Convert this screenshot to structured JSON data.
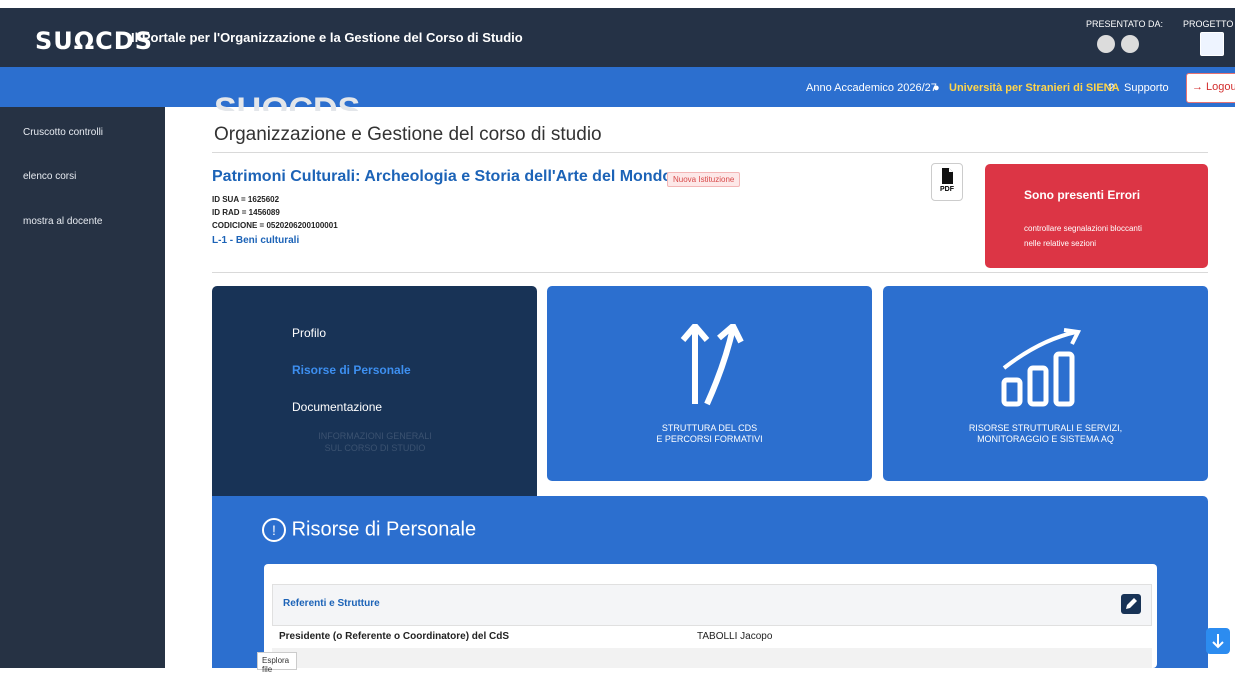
{
  "header": {
    "logo": "SUΩCDS",
    "title": "Il Portale per l'Organizzazione e la Gestione del Corso di Studio",
    "presented_by": "PRESENTATO DA:",
    "project_by": "PROGETTO DI"
  },
  "nav": {
    "academic_year": "Anno Accademico 2026/27",
    "university": "Università per Stranieri di SIENA",
    "support": "Supporto",
    "logout": "Logout"
  },
  "sidebar": {
    "items": [
      {
        "label": "Cruscotto controlli"
      },
      {
        "label": "elenco corsi"
      },
      {
        "label": "mostra al docente"
      }
    ]
  },
  "page": {
    "title": "Organizzazione e Gestione del corso di studio"
  },
  "course": {
    "title": "Patrimoni Culturali: Archeologia e Storia dell'Arte del Mondo",
    "tag": "Nuova Istituzione",
    "id_sua": "ID SUA = 1625602",
    "id_rad": "ID RAD = 1456089",
    "codicione": "CODICIONE = 0520206200100001",
    "classe": "L-1 - Beni culturali",
    "pdf_label": "PDF"
  },
  "errors": {
    "title": "Sono presenti Errori",
    "line1": "controllare segnalazioni bloccanti",
    "line2": "nelle relative sezioni"
  },
  "tiles": {
    "t1": {
      "items": [
        "Profilo",
        "Risorse di Personale",
        "Documentazione"
      ],
      "ghost1": "INFORMAZIONI GENERALI",
      "ghost2": "SUL CORSO DI STUDIO"
    },
    "t2": {
      "line1": "STRUTTURA DEL CDS",
      "line2": "E PERCORSI FORMATIVI"
    },
    "t3": {
      "line1": "RISORSE STRUTTURALI E SERVIZI,",
      "line2": "MONITORAGGIO E SISTEMA AQ"
    }
  },
  "section": {
    "title": "Risorse di Personale",
    "card_title": "Referenti e Strutture",
    "row_label": "Presidente (o Referente o Coordinatore) del CdS",
    "row_value": "TABOLLI Jacopo"
  },
  "tooltip": "Esplora file",
  "colors": {
    "header_bg": "#253246",
    "nav_bg": "#2c6fcf",
    "error_bg": "#dc3545",
    "title_blue": "#1c63b7"
  }
}
